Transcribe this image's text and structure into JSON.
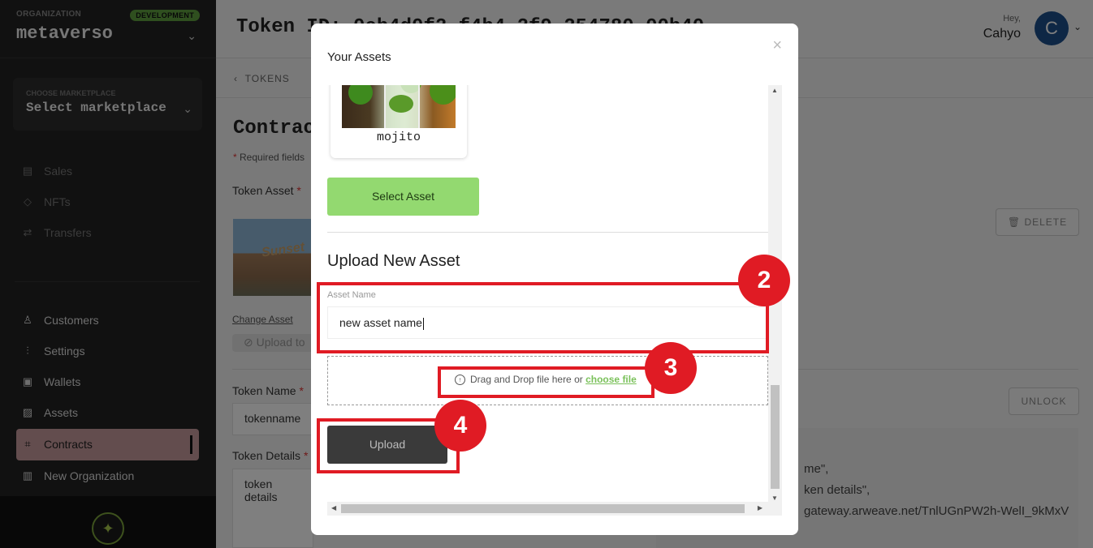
{
  "sidebar": {
    "org_label": "ORGANIZATION",
    "org_name": "metaverso",
    "env_badge": "DEVELOPMENT",
    "marketplace_label": "CHOOSE MARKETPLACE",
    "marketplace_value": "Select marketplace",
    "nav_dim": [
      {
        "label": "Sales",
        "icon": "store-icon"
      },
      {
        "label": "NFTs",
        "icon": "diamond-icon"
      },
      {
        "label": "Transfers",
        "icon": "transfer-icon"
      }
    ],
    "nav": [
      {
        "label": "Customers",
        "icon": "user-icon"
      },
      {
        "label": "Settings",
        "icon": "sliders-icon"
      },
      {
        "label": "Wallets",
        "icon": "wallet-icon"
      },
      {
        "label": "Assets",
        "icon": "image-icon"
      },
      {
        "label": "Contracts",
        "icon": "contract-icon",
        "active": true
      },
      {
        "label": "New Organization",
        "icon": "building-icon"
      }
    ]
  },
  "header": {
    "title": "Token ID: 0cb4d0f2-f4b4-2f9  254780 00b40",
    "greeting": "Hey,",
    "user_name": "Cahyo",
    "avatar_initial": "C"
  },
  "page": {
    "breadcrumb": "TOKENS",
    "section_title": "Contrac",
    "required_note": "Required fields",
    "token_asset_label": "Token Asset",
    "change_asset_link": "Change Asset",
    "upload_pill": "Upload to",
    "delete_button": "DELETE",
    "token_name_label": "Token Name",
    "token_name_value": "tokenname",
    "token_details_label": "Token Details",
    "token_details_value": "token details",
    "unlock_button": "UNLOCK",
    "code_lines": [
      "me\",",
      "ken details\",",
      "gateway.arweave.net/TnlUGnPW2h-WelI_9kMxV"
    ]
  },
  "modal": {
    "title": "Your Assets",
    "close_glyph": "×",
    "asset_card_name": "mojito",
    "select_button": "Select Asset",
    "upload_heading": "Upload New Asset",
    "asset_name_label": "Asset Name",
    "asset_name_value": "new asset name",
    "drop_text": "Drag and Drop file here or",
    "choose_file_link": "choose file",
    "upload_button": "Upload"
  },
  "annotations": [
    {
      "number": "2"
    },
    {
      "number": "3"
    },
    {
      "number": "4"
    }
  ],
  "colors": {
    "sidebar_bg": "#222222",
    "active_nav": "#c79a9c",
    "select_button": "#93d970",
    "upload_button": "#3a3a3a",
    "annotation_red": "#e01b24",
    "avatar_bg": "#1d4f8a",
    "badge": "#5e9e3f"
  }
}
